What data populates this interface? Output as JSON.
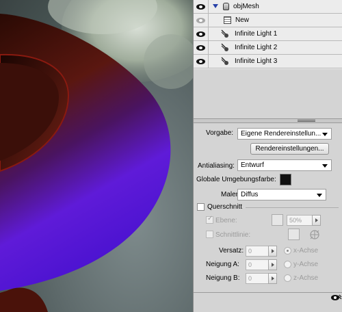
{
  "layers": [
    {
      "name": "objMesh",
      "visible": true,
      "icon": "mesh-object-icon",
      "expanded": true
    },
    {
      "name": "New",
      "visible": false,
      "icon": "texture-grid-icon"
    },
    {
      "name": "Infinite Light 1",
      "visible": true,
      "icon": "infinite-light-icon"
    },
    {
      "name": "Infinite Light 2",
      "visible": true,
      "icon": "infinite-light-icon"
    },
    {
      "name": "Infinite Light 3",
      "visible": true,
      "icon": "infinite-light-icon"
    }
  ],
  "render": {
    "preset_label": "Vorgabe:",
    "preset_value": "Eigene Rendereinstellun...",
    "settings_button": "Rendereinstellungen...",
    "antialiasing_label": "Antialiasing:",
    "antialiasing_value": "Entwurf",
    "ambient_label": "Globale Umgebungsfarbe:",
    "ambient_color": "#111111",
    "paint_on_label": "Malen auf:",
    "paint_on_value": "Diffus"
  },
  "cross_section": {
    "label": "Querschnitt",
    "plane_label": "Ebene:",
    "plane_percent": "50%",
    "intersection_label": "Schnittlinie:",
    "offset_label": "Versatz:",
    "offset_value": "0",
    "tilt_a_label": "Neigung A:",
    "tilt_a_value": "0",
    "tilt_b_label": "Neigung B:",
    "tilt_b_value": "0",
    "axis_x": "x-Achse",
    "axis_y": "y-Achse",
    "axis_z": "z-Achse"
  },
  "colors": {
    "mesh_top": "#3a1008",
    "mesh_bottom": "#6a1ee8",
    "panel_bg": "#d4d4d4"
  }
}
